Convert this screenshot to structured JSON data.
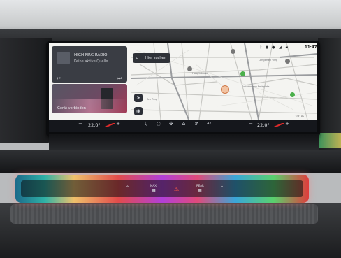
{
  "media": {
    "title": "HIGH NRG RADIO",
    "subtitle": "Keine aktive Quelle",
    "prev_icon": "skip-previous-icon",
    "next_icon": "skip-next-icon"
  },
  "phone": {
    "label": "Gerät verbinden"
  },
  "search": {
    "label": "Hier suchen"
  },
  "status": {
    "time": "11:47"
  },
  "map": {
    "labels": [
      "Lohgarten Weg",
      "Sonnenberg Parkplatz",
      "Hauptstraße",
      "Am Ring"
    ],
    "scale": "100 m"
  },
  "climate": {
    "left_temp": "22.0°",
    "right_temp": "22.0°",
    "left_minus": "−",
    "left_plus": "+",
    "right_minus": "−",
    "right_plus": "+"
  },
  "strip": {
    "max_label": "MAX",
    "rear_label": "REAR"
  },
  "colors": {
    "accent_red": "#e02b2b",
    "screen_bg": "#f4f4f1",
    "bar_bg": "#15171c"
  }
}
